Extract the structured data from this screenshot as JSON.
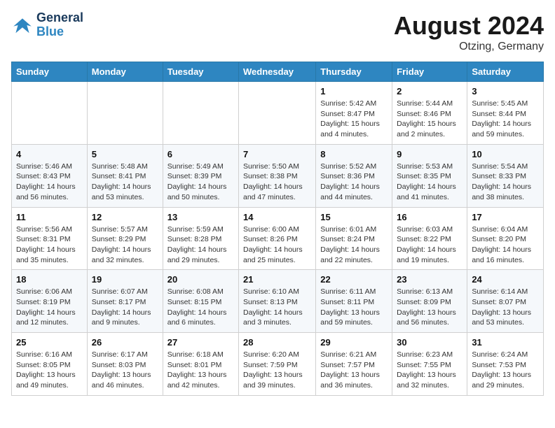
{
  "header": {
    "logo_line1": "General",
    "logo_line2": "Blue",
    "title": "August 2024",
    "location": "Otzing, Germany"
  },
  "days_of_week": [
    "Sunday",
    "Monday",
    "Tuesday",
    "Wednesday",
    "Thursday",
    "Friday",
    "Saturday"
  ],
  "weeks": [
    [
      {
        "day": "",
        "info": ""
      },
      {
        "day": "",
        "info": ""
      },
      {
        "day": "",
        "info": ""
      },
      {
        "day": "",
        "info": ""
      },
      {
        "day": "1",
        "info": "Sunrise: 5:42 AM\nSunset: 8:47 PM\nDaylight: 15 hours\nand 4 minutes."
      },
      {
        "day": "2",
        "info": "Sunrise: 5:44 AM\nSunset: 8:46 PM\nDaylight: 15 hours\nand 2 minutes."
      },
      {
        "day": "3",
        "info": "Sunrise: 5:45 AM\nSunset: 8:44 PM\nDaylight: 14 hours\nand 59 minutes."
      }
    ],
    [
      {
        "day": "4",
        "info": "Sunrise: 5:46 AM\nSunset: 8:43 PM\nDaylight: 14 hours\nand 56 minutes."
      },
      {
        "day": "5",
        "info": "Sunrise: 5:48 AM\nSunset: 8:41 PM\nDaylight: 14 hours\nand 53 minutes."
      },
      {
        "day": "6",
        "info": "Sunrise: 5:49 AM\nSunset: 8:39 PM\nDaylight: 14 hours\nand 50 minutes."
      },
      {
        "day": "7",
        "info": "Sunrise: 5:50 AM\nSunset: 8:38 PM\nDaylight: 14 hours\nand 47 minutes."
      },
      {
        "day": "8",
        "info": "Sunrise: 5:52 AM\nSunset: 8:36 PM\nDaylight: 14 hours\nand 44 minutes."
      },
      {
        "day": "9",
        "info": "Sunrise: 5:53 AM\nSunset: 8:35 PM\nDaylight: 14 hours\nand 41 minutes."
      },
      {
        "day": "10",
        "info": "Sunrise: 5:54 AM\nSunset: 8:33 PM\nDaylight: 14 hours\nand 38 minutes."
      }
    ],
    [
      {
        "day": "11",
        "info": "Sunrise: 5:56 AM\nSunset: 8:31 PM\nDaylight: 14 hours\nand 35 minutes."
      },
      {
        "day": "12",
        "info": "Sunrise: 5:57 AM\nSunset: 8:29 PM\nDaylight: 14 hours\nand 32 minutes."
      },
      {
        "day": "13",
        "info": "Sunrise: 5:59 AM\nSunset: 8:28 PM\nDaylight: 14 hours\nand 29 minutes."
      },
      {
        "day": "14",
        "info": "Sunrise: 6:00 AM\nSunset: 8:26 PM\nDaylight: 14 hours\nand 25 minutes."
      },
      {
        "day": "15",
        "info": "Sunrise: 6:01 AM\nSunset: 8:24 PM\nDaylight: 14 hours\nand 22 minutes."
      },
      {
        "day": "16",
        "info": "Sunrise: 6:03 AM\nSunset: 8:22 PM\nDaylight: 14 hours\nand 19 minutes."
      },
      {
        "day": "17",
        "info": "Sunrise: 6:04 AM\nSunset: 8:20 PM\nDaylight: 14 hours\nand 16 minutes."
      }
    ],
    [
      {
        "day": "18",
        "info": "Sunrise: 6:06 AM\nSunset: 8:19 PM\nDaylight: 14 hours\nand 12 minutes."
      },
      {
        "day": "19",
        "info": "Sunrise: 6:07 AM\nSunset: 8:17 PM\nDaylight: 14 hours\nand 9 minutes."
      },
      {
        "day": "20",
        "info": "Sunrise: 6:08 AM\nSunset: 8:15 PM\nDaylight: 14 hours\nand 6 minutes."
      },
      {
        "day": "21",
        "info": "Sunrise: 6:10 AM\nSunset: 8:13 PM\nDaylight: 14 hours\nand 3 minutes."
      },
      {
        "day": "22",
        "info": "Sunrise: 6:11 AM\nSunset: 8:11 PM\nDaylight: 13 hours\nand 59 minutes."
      },
      {
        "day": "23",
        "info": "Sunrise: 6:13 AM\nSunset: 8:09 PM\nDaylight: 13 hours\nand 56 minutes."
      },
      {
        "day": "24",
        "info": "Sunrise: 6:14 AM\nSunset: 8:07 PM\nDaylight: 13 hours\nand 53 minutes."
      }
    ],
    [
      {
        "day": "25",
        "info": "Sunrise: 6:16 AM\nSunset: 8:05 PM\nDaylight: 13 hours\nand 49 minutes."
      },
      {
        "day": "26",
        "info": "Sunrise: 6:17 AM\nSunset: 8:03 PM\nDaylight: 13 hours\nand 46 minutes."
      },
      {
        "day": "27",
        "info": "Sunrise: 6:18 AM\nSunset: 8:01 PM\nDaylight: 13 hours\nand 42 minutes."
      },
      {
        "day": "28",
        "info": "Sunrise: 6:20 AM\nSunset: 7:59 PM\nDaylight: 13 hours\nand 39 minutes."
      },
      {
        "day": "29",
        "info": "Sunrise: 6:21 AM\nSunset: 7:57 PM\nDaylight: 13 hours\nand 36 minutes."
      },
      {
        "day": "30",
        "info": "Sunrise: 6:23 AM\nSunset: 7:55 PM\nDaylight: 13 hours\nand 32 minutes."
      },
      {
        "day": "31",
        "info": "Sunrise: 6:24 AM\nSunset: 7:53 PM\nDaylight: 13 hours\nand 29 minutes."
      }
    ]
  ]
}
